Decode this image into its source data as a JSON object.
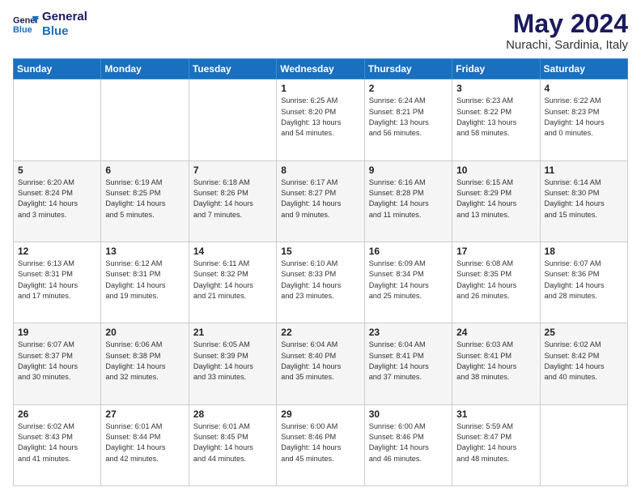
{
  "logo": {
    "line1": "General",
    "line2": "Blue"
  },
  "title": "May 2024",
  "subtitle": "Nurachi, Sardinia, Italy",
  "days_of_week": [
    "Sunday",
    "Monday",
    "Tuesday",
    "Wednesday",
    "Thursday",
    "Friday",
    "Saturday"
  ],
  "weeks": [
    [
      {
        "day": "",
        "info": ""
      },
      {
        "day": "",
        "info": ""
      },
      {
        "day": "",
        "info": ""
      },
      {
        "day": "1",
        "info": "Sunrise: 6:25 AM\nSunset: 8:20 PM\nDaylight: 13 hours\nand 54 minutes."
      },
      {
        "day": "2",
        "info": "Sunrise: 6:24 AM\nSunset: 8:21 PM\nDaylight: 13 hours\nand 56 minutes."
      },
      {
        "day": "3",
        "info": "Sunrise: 6:23 AM\nSunset: 8:22 PM\nDaylight: 13 hours\nand 58 minutes."
      },
      {
        "day": "4",
        "info": "Sunrise: 6:22 AM\nSunset: 8:23 PM\nDaylight: 14 hours\nand 0 minutes."
      }
    ],
    [
      {
        "day": "5",
        "info": "Sunrise: 6:20 AM\nSunset: 8:24 PM\nDaylight: 14 hours\nand 3 minutes."
      },
      {
        "day": "6",
        "info": "Sunrise: 6:19 AM\nSunset: 8:25 PM\nDaylight: 14 hours\nand 5 minutes."
      },
      {
        "day": "7",
        "info": "Sunrise: 6:18 AM\nSunset: 8:26 PM\nDaylight: 14 hours\nand 7 minutes."
      },
      {
        "day": "8",
        "info": "Sunrise: 6:17 AM\nSunset: 8:27 PM\nDaylight: 14 hours\nand 9 minutes."
      },
      {
        "day": "9",
        "info": "Sunrise: 6:16 AM\nSunset: 8:28 PM\nDaylight: 14 hours\nand 11 minutes."
      },
      {
        "day": "10",
        "info": "Sunrise: 6:15 AM\nSunset: 8:29 PM\nDaylight: 14 hours\nand 13 minutes."
      },
      {
        "day": "11",
        "info": "Sunrise: 6:14 AM\nSunset: 8:30 PM\nDaylight: 14 hours\nand 15 minutes."
      }
    ],
    [
      {
        "day": "12",
        "info": "Sunrise: 6:13 AM\nSunset: 8:31 PM\nDaylight: 14 hours\nand 17 minutes."
      },
      {
        "day": "13",
        "info": "Sunrise: 6:12 AM\nSunset: 8:31 PM\nDaylight: 14 hours\nand 19 minutes."
      },
      {
        "day": "14",
        "info": "Sunrise: 6:11 AM\nSunset: 8:32 PM\nDaylight: 14 hours\nand 21 minutes."
      },
      {
        "day": "15",
        "info": "Sunrise: 6:10 AM\nSunset: 8:33 PM\nDaylight: 14 hours\nand 23 minutes."
      },
      {
        "day": "16",
        "info": "Sunrise: 6:09 AM\nSunset: 8:34 PM\nDaylight: 14 hours\nand 25 minutes."
      },
      {
        "day": "17",
        "info": "Sunrise: 6:08 AM\nSunset: 8:35 PM\nDaylight: 14 hours\nand 26 minutes."
      },
      {
        "day": "18",
        "info": "Sunrise: 6:07 AM\nSunset: 8:36 PM\nDaylight: 14 hours\nand 28 minutes."
      }
    ],
    [
      {
        "day": "19",
        "info": "Sunrise: 6:07 AM\nSunset: 8:37 PM\nDaylight: 14 hours\nand 30 minutes."
      },
      {
        "day": "20",
        "info": "Sunrise: 6:06 AM\nSunset: 8:38 PM\nDaylight: 14 hours\nand 32 minutes."
      },
      {
        "day": "21",
        "info": "Sunrise: 6:05 AM\nSunset: 8:39 PM\nDaylight: 14 hours\nand 33 minutes."
      },
      {
        "day": "22",
        "info": "Sunrise: 6:04 AM\nSunset: 8:40 PM\nDaylight: 14 hours\nand 35 minutes."
      },
      {
        "day": "23",
        "info": "Sunrise: 6:04 AM\nSunset: 8:41 PM\nDaylight: 14 hours\nand 37 minutes."
      },
      {
        "day": "24",
        "info": "Sunrise: 6:03 AM\nSunset: 8:41 PM\nDaylight: 14 hours\nand 38 minutes."
      },
      {
        "day": "25",
        "info": "Sunrise: 6:02 AM\nSunset: 8:42 PM\nDaylight: 14 hours\nand 40 minutes."
      }
    ],
    [
      {
        "day": "26",
        "info": "Sunrise: 6:02 AM\nSunset: 8:43 PM\nDaylight: 14 hours\nand 41 minutes."
      },
      {
        "day": "27",
        "info": "Sunrise: 6:01 AM\nSunset: 8:44 PM\nDaylight: 14 hours\nand 42 minutes."
      },
      {
        "day": "28",
        "info": "Sunrise: 6:01 AM\nSunset: 8:45 PM\nDaylight: 14 hours\nand 44 minutes."
      },
      {
        "day": "29",
        "info": "Sunrise: 6:00 AM\nSunset: 8:46 PM\nDaylight: 14 hours\nand 45 minutes."
      },
      {
        "day": "30",
        "info": "Sunrise: 6:00 AM\nSunset: 8:46 PM\nDaylight: 14 hours\nand 46 minutes."
      },
      {
        "day": "31",
        "info": "Sunrise: 5:59 AM\nSunset: 8:47 PM\nDaylight: 14 hours\nand 48 minutes."
      },
      {
        "day": "",
        "info": ""
      }
    ]
  ]
}
